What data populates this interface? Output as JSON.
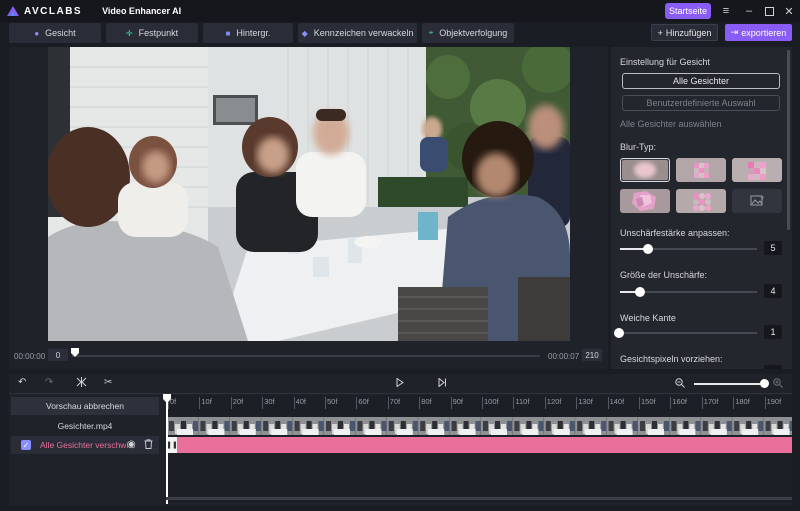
{
  "app": {
    "brand": "AVCLABS",
    "name": "Video Enhancer AI"
  },
  "titlebar": {
    "startseite": "Startseite",
    "controls": [
      "menu-icon",
      "minimize-icon",
      "maximize-icon",
      "close-icon"
    ]
  },
  "toolbar": {
    "tabs": [
      {
        "label": "Gesicht",
        "icon": "face-icon",
        "color": "#8a8fff"
      },
      {
        "label": "Festpunkt",
        "icon": "crosshair-icon",
        "color": "#3fd3a0"
      },
      {
        "label": "Hintergr.",
        "icon": "background-icon",
        "color": "#7b8cff"
      },
      {
        "label": "Kennzeichen verwackeln",
        "icon": "car-icon",
        "color": "#8a8fff"
      },
      {
        "label": "Objektverfolgung",
        "icon": "tracking-icon",
        "color": "#3fd3a0"
      }
    ],
    "add_label": "Hinzufügen",
    "export_label": "exportieren"
  },
  "preview": {
    "time_start": "00:00:00",
    "frame_start": "0",
    "time_end": "00:00:07",
    "frame_end": "210"
  },
  "panel": {
    "title": "Einstellung für Gesicht",
    "all_faces": "Alle Gesichter",
    "custom_selection": "Benutzerdefinierte Auswahl",
    "select_all_hint": "Alle Gesichter auswählen",
    "blur_type_label": "Blur-Typ:",
    "sharpness_label": "Unschärfestärke anpassen:",
    "sharpness_value": "5",
    "blur_size_label": "Größe der Unschärfe:",
    "blur_size_value": "4",
    "soft_edge_label": "Weiche Kante",
    "soft_edge_value": "1",
    "face_pixels_label": "Gesichtspixeln vorziehen:"
  },
  "timeline": {
    "cancel_preview": "Vorschau abbrechen",
    "file_name": "Gesichter.mp4",
    "track_label": "Alle Gesichter verschwi...",
    "ticks": [
      "0f",
      "10f",
      "20f",
      "30f",
      "40f",
      "50f",
      "60f",
      "70f",
      "80f",
      "90f",
      "100f",
      "110f",
      "120f",
      "130f",
      "140f",
      "150f",
      "160f",
      "170f",
      "180f",
      "190f"
    ],
    "track_color": "#e8709a",
    "zoom_level": 0.92
  }
}
